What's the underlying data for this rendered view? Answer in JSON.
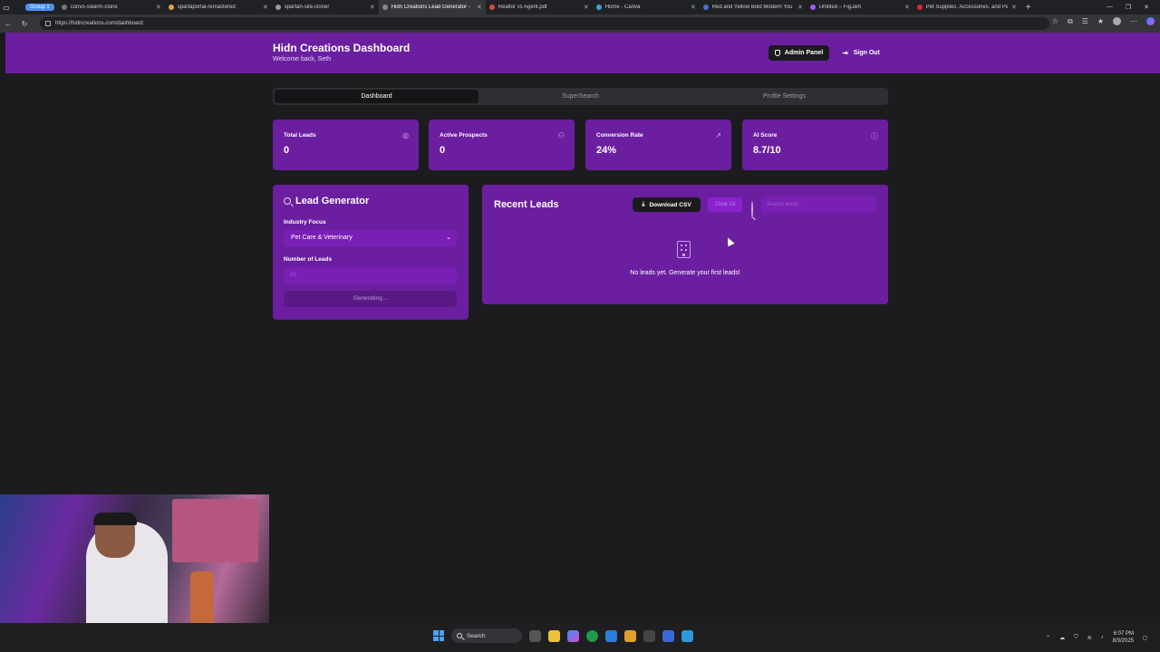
{
  "browser": {
    "group_label": "Group 1",
    "tabs": [
      {
        "title": "convo-swarm-clone"
      },
      {
        "title": "spartaportal-remastered"
      },
      {
        "title": "spartan-site-cloner"
      },
      {
        "title": "Hidn Creations Lead Generator -"
      },
      {
        "title": "Realtor vs Agent.pdf"
      },
      {
        "title": "Home - Canva"
      },
      {
        "title": "Red and Yellow Bold Modern You"
      },
      {
        "title": "Untitled – FigJam"
      },
      {
        "title": "Pet Supplies, Accessories, and Pe"
      }
    ],
    "active_tab_index": 3,
    "url": "https://hidncreations.com/dashboard"
  },
  "header": {
    "title": "Hidn Creations Dashboard",
    "subtitle": "Welcome back, Seth",
    "admin_label": "Admin Panel",
    "signout_label": "Sign Out"
  },
  "nav_tabs": [
    {
      "label": "Dashboard",
      "active": true
    },
    {
      "label": "SuperSearch",
      "active": false
    },
    {
      "label": "Profile Settings",
      "active": false
    }
  ],
  "stats": [
    {
      "label": "Total Leads",
      "value": "0",
      "icon": "target-icon"
    },
    {
      "label": "Active Prospects",
      "value": "0",
      "icon": "users-icon"
    },
    {
      "label": "Conversion Rate",
      "value": "24%",
      "icon": "trending-up-icon"
    },
    {
      "label": "AI Score",
      "value": "8.7/10",
      "icon": "info-icon"
    }
  ],
  "lead_generator": {
    "title": "Lead Generator",
    "industry_label": "Industry Focus",
    "industry_value": "Pet Care & Veterinary",
    "count_label": "Number of Leads",
    "count_placeholder": "10",
    "button_label": "Generating..."
  },
  "recent_leads": {
    "title": "Recent Leads",
    "download_label": "Download CSV",
    "clear_label": "Clear All",
    "search_placeholder": "Search leads...",
    "empty_message": "No leads yet. Generate your first leads!"
  },
  "taskbar": {
    "search_label": "Search",
    "time": "6:07 PM",
    "date": "8/3/2025"
  },
  "colors": {
    "brand_purple": "#6b1fa0",
    "input_purple": "#7a1fb5",
    "background": "#1c1c1e"
  }
}
